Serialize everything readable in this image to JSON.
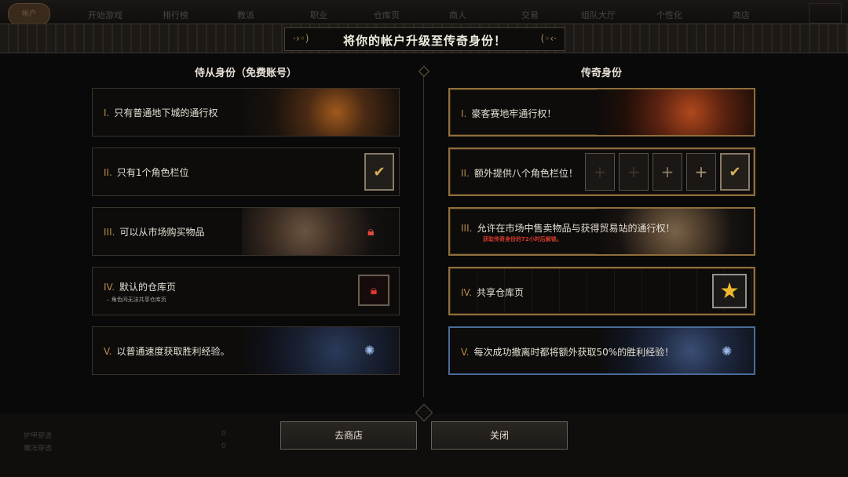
{
  "colors": {
    "gold_border": "#8f6e3c",
    "blue_border": "#4b6c9a",
    "numeral": "#b88a4a",
    "warning_red": "#d23a2a",
    "star": "#f0b830"
  },
  "top_nav": {
    "logo": "帐户",
    "items": [
      "开始游戏",
      "排行榜",
      "教派",
      "职业",
      "仓库页",
      "商人",
      "交易",
      "组队大厅",
      "个性化",
      "商店"
    ]
  },
  "banner": {
    "title": "将你的帐户升级至传奇身份！"
  },
  "free": {
    "title": "侍从身份（免费账号）",
    "rows": [
      {
        "num": "I.",
        "text": "只有普通地下城的通行权"
      },
      {
        "num": "II.",
        "text": "只有1个角色栏位"
      },
      {
        "num": "III.",
        "text": "可以从市场购买物品"
      },
      {
        "num": "IV.",
        "text": "默认的仓库页",
        "sub": "– 角色间无法共享仓库页"
      },
      {
        "num": "V.",
        "text": "以普通速度获取胜利经验。"
      }
    ]
  },
  "legend": {
    "title": "传奇身份",
    "rows": [
      {
        "num": "I.",
        "text": "豪客赛地牢通行权！"
      },
      {
        "num": "II.",
        "text": "额外提供八个角色栏位！"
      },
      {
        "num": "III.",
        "text": "允许在市场中售卖物品与获得贸易站的通行权！",
        "sub": "获取传奇身份的72小时后解锁。"
      },
      {
        "num": "IV.",
        "text": "共享仓库页"
      },
      {
        "num": "V.",
        "text": "每次成功撤离时都将额外获取50%的胜利经验！"
      }
    ]
  },
  "icons": {
    "check": "checkmark-icon",
    "plus": "plus-icon",
    "lock": "lock-icon",
    "star": "star-icon",
    "rune": "rune-icon"
  },
  "stats": {
    "armor_label": "护甲穿透",
    "armor_value": "0",
    "magic_label": "魔法穿透",
    "magic_value": "0"
  },
  "buttons": {
    "shop": "去商店",
    "close": "关闭"
  }
}
